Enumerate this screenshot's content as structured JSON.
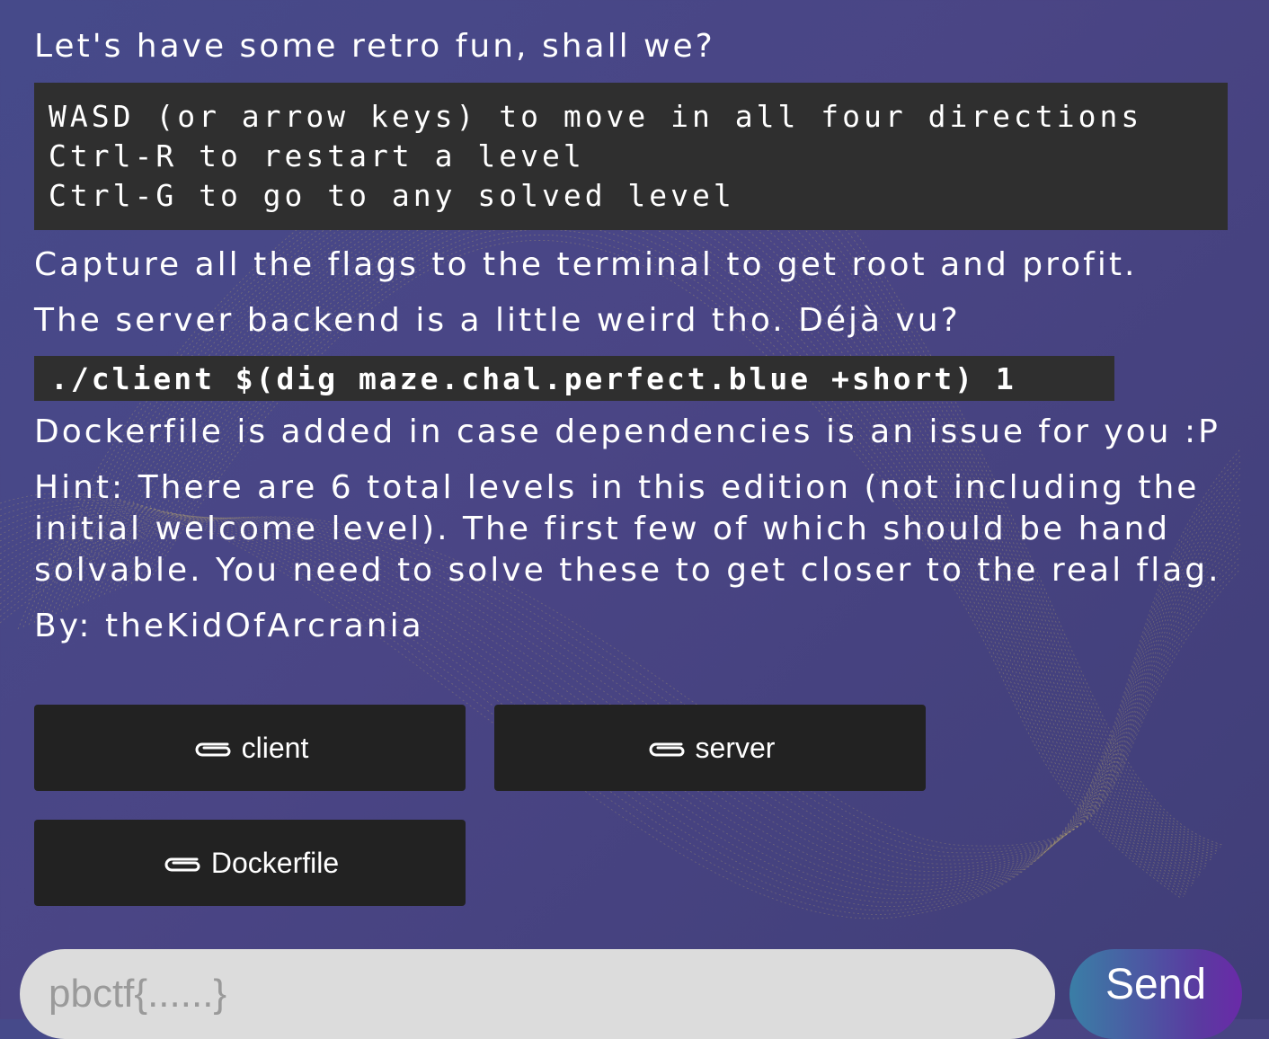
{
  "challenge": {
    "intro": "Let's have some retro fun, shall we?",
    "controls": [
      "WASD (or arrow keys) to move in all four directions",
      "Ctrl-R to restart a level",
      "Ctrl-G to go to any solved level"
    ],
    "capture_text": "Capture all the flags to the terminal to get root and profit.",
    "server_text": "The server backend is a little weird tho. Déjà vu?",
    "command": "./client $(dig maze.chal.perfect.blue +short) 1",
    "dockerfile_note": "Dockerfile is added in case dependencies is an issue for you :P",
    "hint_lines": [
      "Hint: There are 6 total levels in this edition (not including the",
      "initial welcome level). The first few of which should be hand",
      "solvable. You need to solve these to get closer to the real flag."
    ],
    "author": "By: theKidOfArcrania"
  },
  "files": [
    {
      "label": "client",
      "icon": "paperclip-icon"
    },
    {
      "label": "server",
      "icon": "paperclip-icon"
    },
    {
      "label": "Dockerfile",
      "icon": "paperclip-icon"
    }
  ],
  "submit": {
    "placeholder": "pbctf{......}",
    "value": "",
    "send_label": "Send"
  },
  "colors": {
    "background": "#464a8a",
    "code_background": "#2f2f2f",
    "button_background": "#222222",
    "input_background": "#dcdcdc",
    "send_gradient_start": "#3a7ea6",
    "send_gradient_end": "#6a2aa8",
    "decor_lines": "#c9b66a"
  }
}
